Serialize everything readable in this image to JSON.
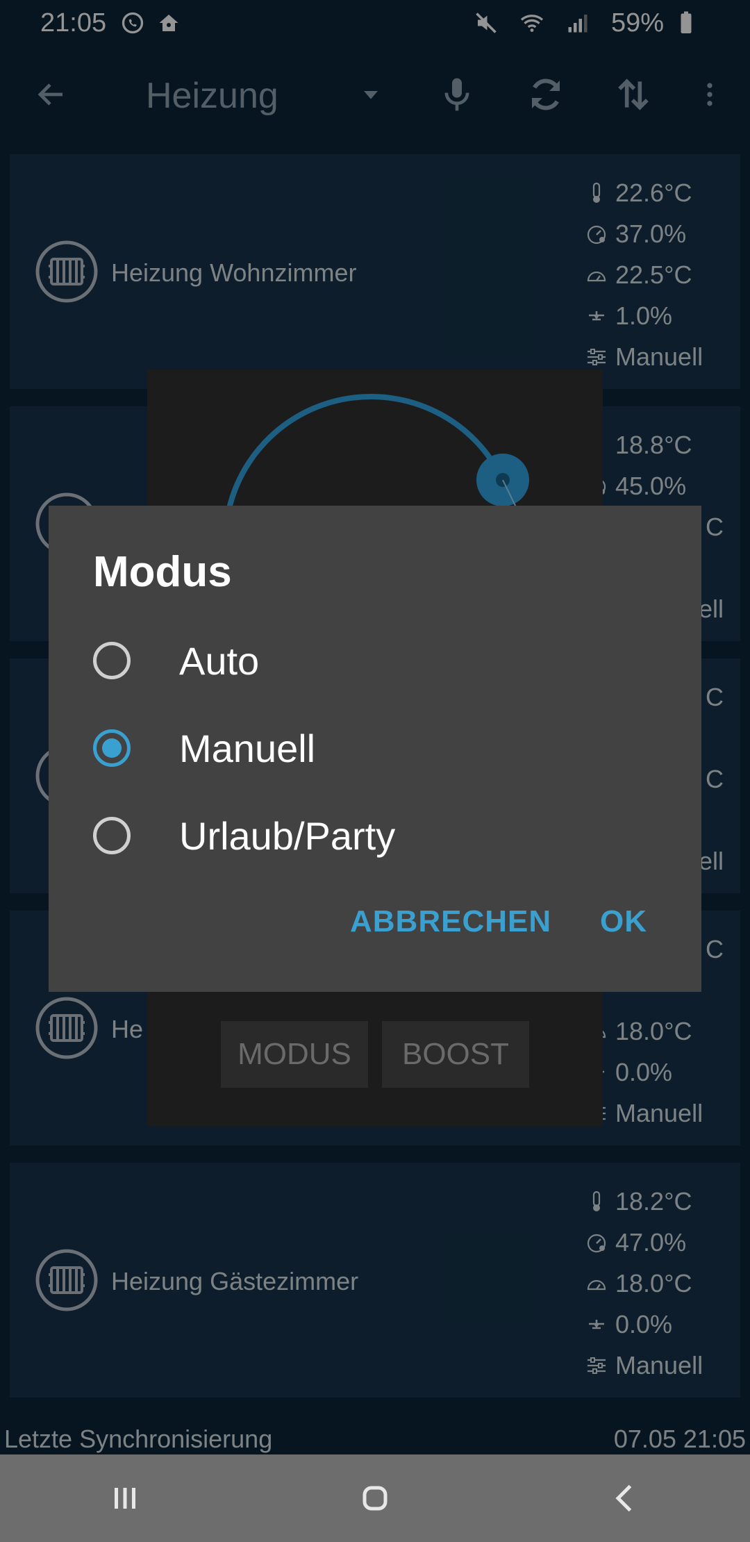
{
  "status_bar": {
    "time": "21:05",
    "battery": "59%",
    "icons": [
      "whatsapp-icon",
      "home-icon",
      "mute-icon",
      "wifi-icon",
      "signal-icon",
      "battery-icon"
    ]
  },
  "app_bar": {
    "title": "Heizung",
    "icons": [
      "back-arrow-icon",
      "dropdown-icon",
      "microphone-icon",
      "refresh-icon",
      "sort-icon",
      "more-vert-icon"
    ]
  },
  "cards": [
    {
      "name": "Heizung Wohnzimmer",
      "stats": [
        "22.6°C",
        "37.0%",
        "22.5°C",
        "1.0%",
        "Manuell"
      ]
    },
    {
      "name": "",
      "stats": [
        "18.8°C",
        "45.0%",
        "",
        "",
        ""
      ]
    },
    {
      "name": "",
      "stats": [
        "",
        "",
        "",
        "",
        ""
      ]
    },
    {
      "name": "He",
      "stats": [
        "",
        "",
        "18.0°C",
        "0.0%",
        "Manuell"
      ]
    },
    {
      "name": "Heizung Gästezimmer",
      "stats": [
        "18.2°C",
        "47.0%",
        "18.0°C",
        "0.0%",
        "Manuell"
      ]
    }
  ],
  "partial_fragments": {
    "card2_stat3": "C",
    "card2_stat5": "ell",
    "card3_stat1": "C",
    "card3_stat3": "C",
    "card3_stat5": "ell",
    "card4_stat1": "C"
  },
  "panel": {
    "mode_button": "MODUS",
    "boost_button": "BOOST"
  },
  "dialog": {
    "title": "Modus",
    "options": [
      {
        "label": "Auto",
        "selected": false
      },
      {
        "label": "Manuell",
        "selected": true
      },
      {
        "label": "Urlaub/Party",
        "selected": false
      }
    ],
    "cancel": "ABBRECHEN",
    "ok": "OK"
  },
  "footer": {
    "sync_label": "Letzte Synchronisierung",
    "sync_time": "07.05 21:05"
  },
  "colors": {
    "accent": "#3aa0d0",
    "background": "#0d2537",
    "card": "#17334a",
    "dialog": "#424242"
  }
}
